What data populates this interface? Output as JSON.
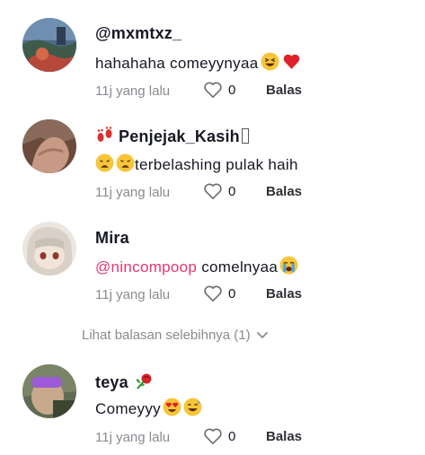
{
  "comments": [
    {
      "username": "@mxmtxz_",
      "text": "hahahaha comeyynyaa",
      "emojis": [
        "laughing-squint-emoji",
        "red-heart-emoji"
      ],
      "time": "11j yang lalu",
      "likes": "0",
      "reply_label": "Balas"
    },
    {
      "username": "Penjejak_Kasih",
      "text": "terbelashing pulak haih",
      "emojis": [
        "footprints-emoji",
        "weary-face-emoji",
        "weary-face-emoji"
      ],
      "time": "11j yang lalu",
      "likes": "0",
      "reply_label": "Balas"
    },
    {
      "username": "Mira",
      "mention": "@nincompoop",
      "text": " comelnyaa",
      "emojis": [
        "loudly-crying-emoji"
      ],
      "time": "11j yang lalu",
      "likes": "0",
      "reply_label": "Balas"
    },
    {
      "username": "teya",
      "text": "Comeyyy",
      "emojis": [
        "rose-emoji",
        "heart-eyes-emoji",
        "grinning-sweat-emoji"
      ],
      "time": "11j yang lalu",
      "likes": "0",
      "reply_label": "Balas"
    }
  ],
  "more_replies_label": "Lihat balasan selebihnya (1)",
  "colors": {
    "mention": "#e3386f",
    "muted": "#8a8b91",
    "text": "#161823"
  }
}
